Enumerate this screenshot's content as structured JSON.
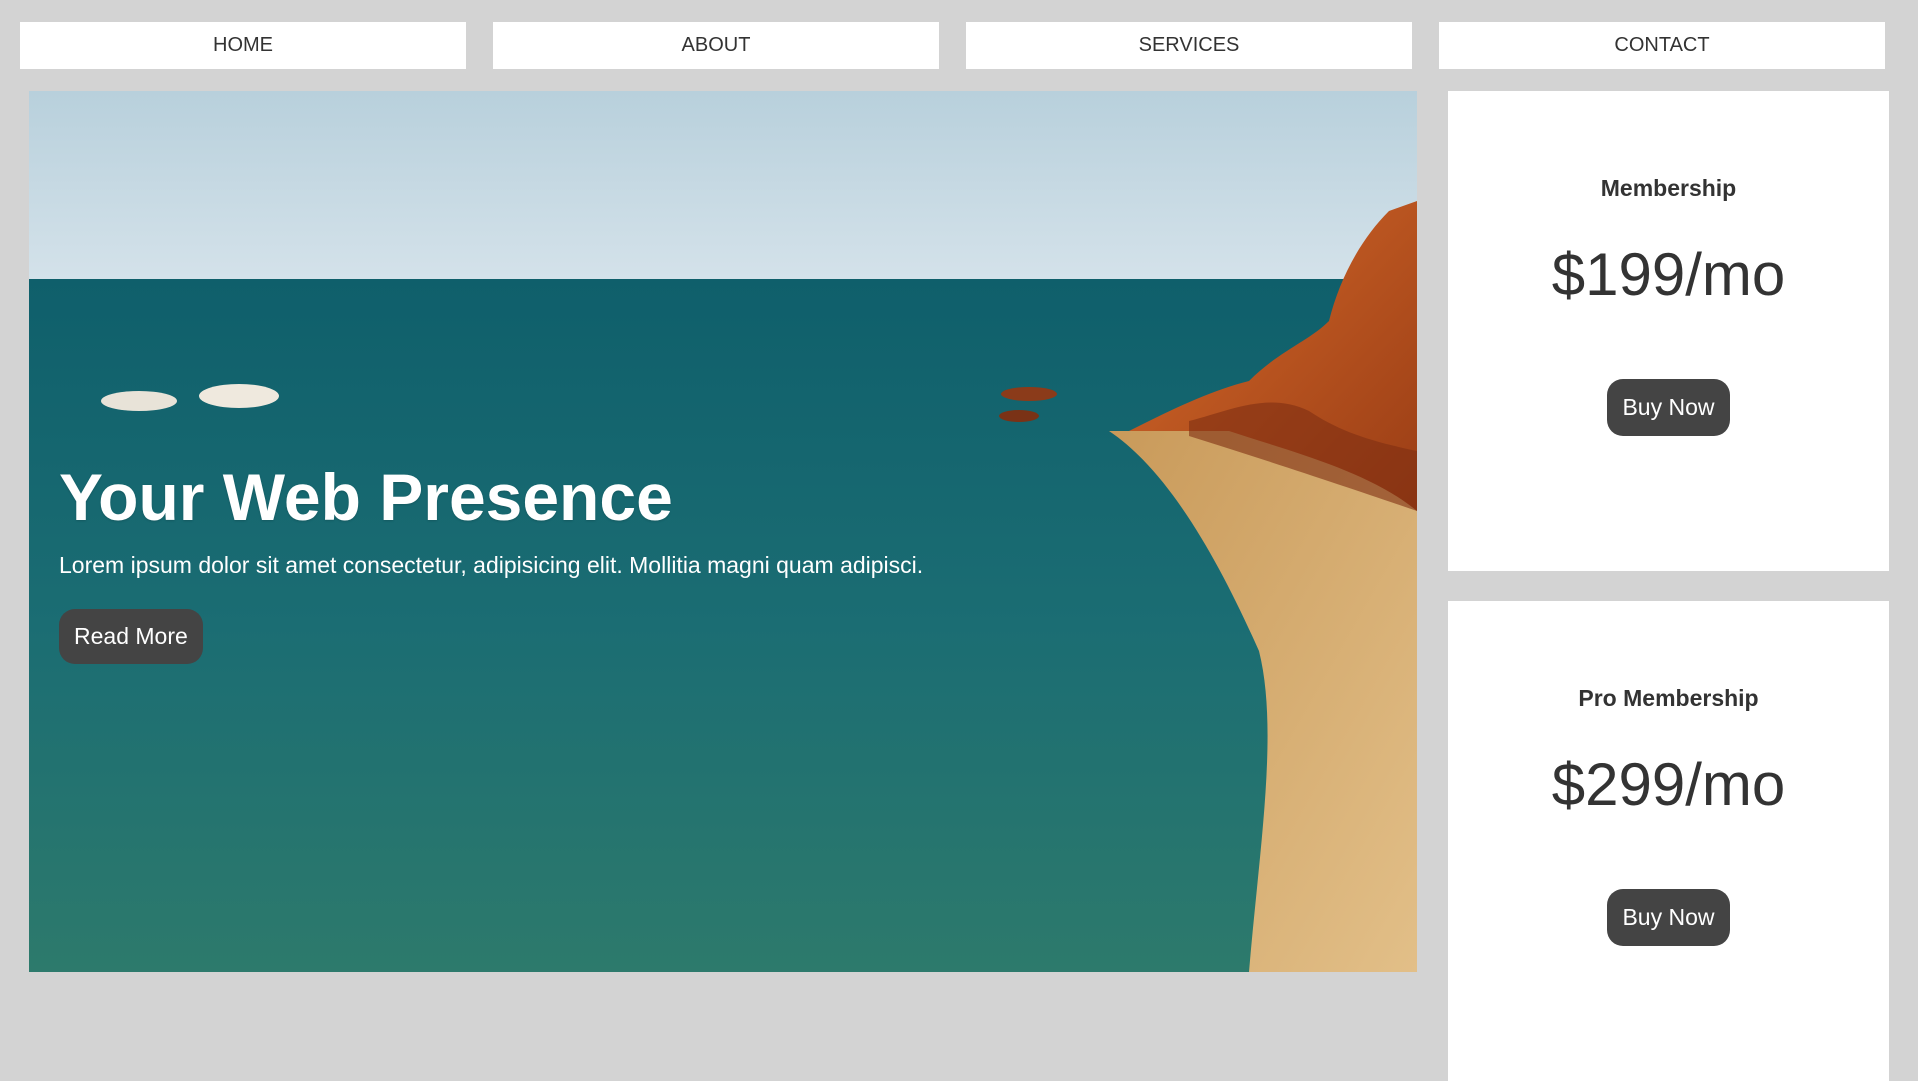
{
  "nav": {
    "items": [
      {
        "label": "HOME"
      },
      {
        "label": "ABOUT"
      },
      {
        "label": "SERVICES"
      },
      {
        "label": "CONTACT"
      }
    ]
  },
  "hero": {
    "title": "Your Web Presence",
    "text": "Lorem ipsum dolor sit amet consectetur, adipisicing elit. Mollitia magni quam adipisci.",
    "button_label": "Read More"
  },
  "pricing": {
    "cards": [
      {
        "title": "Membership",
        "price": "$199/mo",
        "button_label": "Buy Now"
      },
      {
        "title": "Pro Membership",
        "price": "$299/mo",
        "button_label": "Buy Now"
      }
    ]
  },
  "colors": {
    "background": "#d3d3d3",
    "button": "#444444",
    "text": "#333333"
  }
}
